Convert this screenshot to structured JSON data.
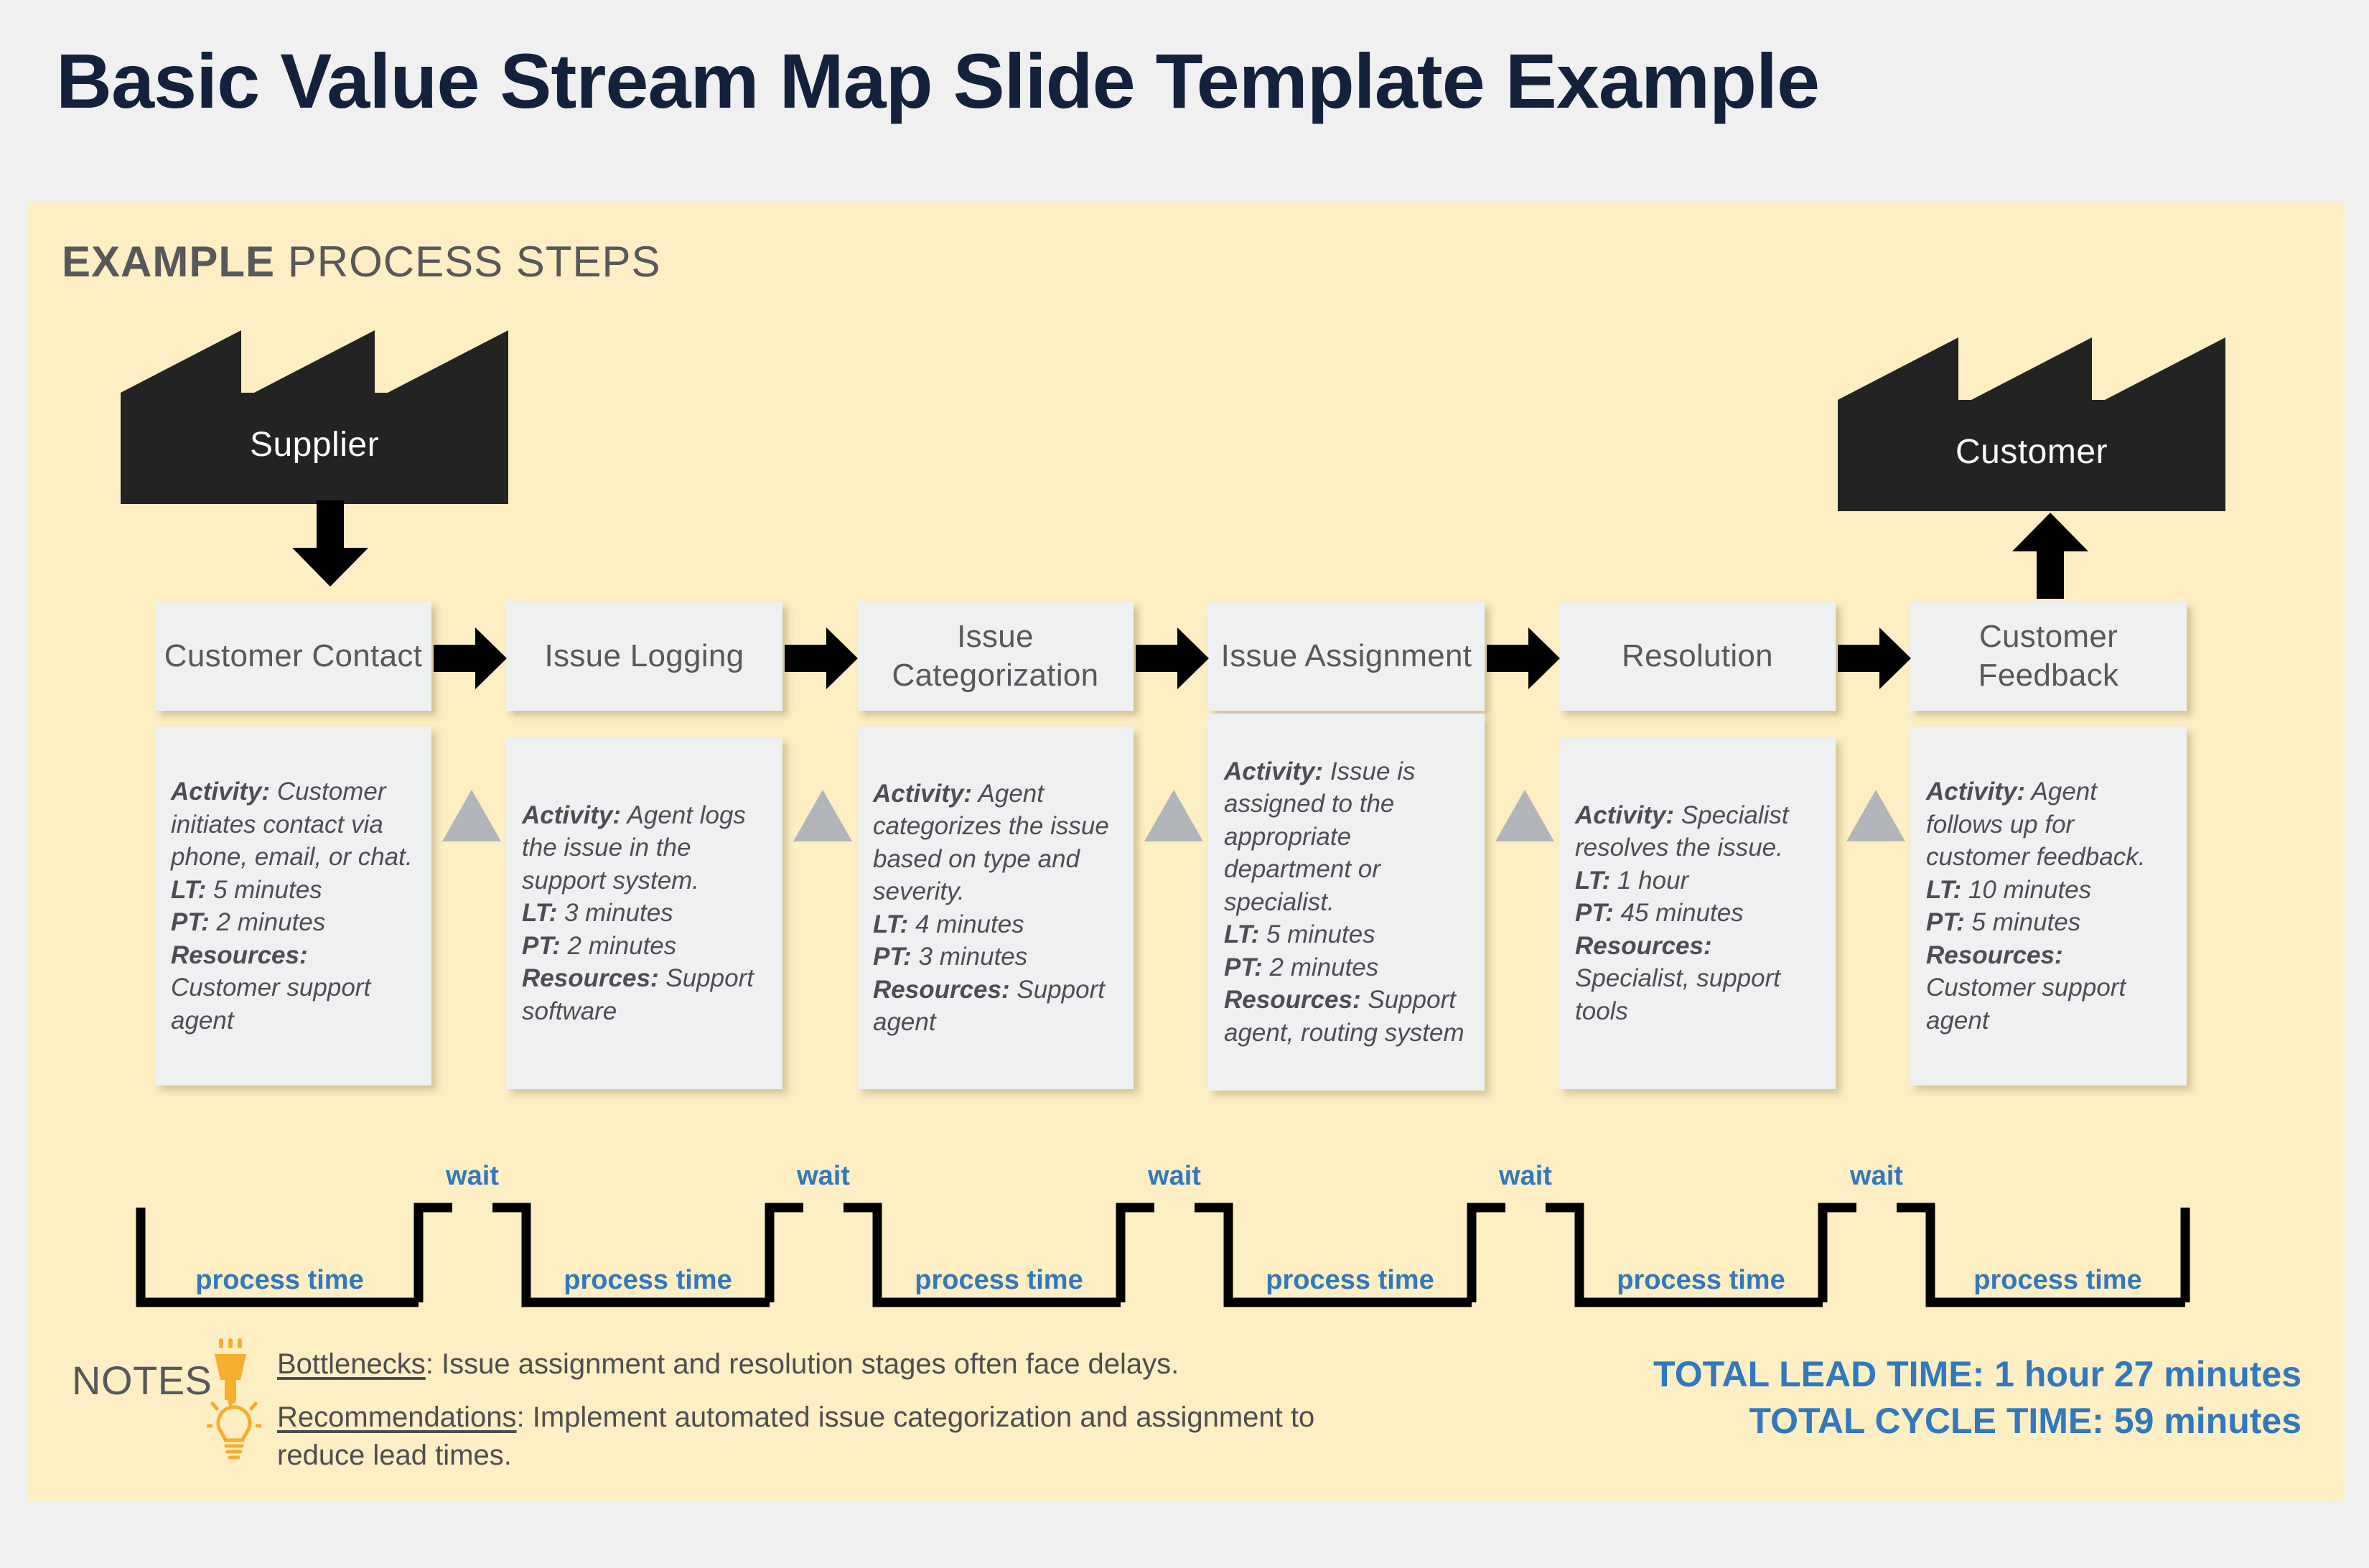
{
  "title": "Basic Value Stream Map Slide Template Example",
  "section": {
    "heading_strong": "EXAMPLE",
    "heading_light": " PROCESS STEPS"
  },
  "colors": {
    "page_background": "#f0f0f0",
    "panel_background": "#fdeec3",
    "title_navy": "#14213d",
    "box_gray": "#eef0f1",
    "text_gray": "#58575a",
    "accent_blue": "#3178be",
    "icon_orange": "#f5ae2e",
    "inventory_gray": "#b1b4b9",
    "factory_black": "#232323"
  },
  "endpoints": {
    "supplier": "Supplier",
    "customer": "Customer"
  },
  "process_steps": [
    {
      "title": "Customer Contact",
      "activity_label": "Activity:",
      "activity": " Customer initiates contact via phone, email, or chat.",
      "lt_label": "LT:",
      "lt": " 5 minutes",
      "pt_label": "PT:",
      "pt": " 2 minutes",
      "resources_label": "Resources:",
      "resources": " Customer support agent"
    },
    {
      "title": "Issue Logging",
      "activity_label": "Activity:",
      "activity": " Agent logs the issue in the support system.",
      "lt_label": "LT:",
      "lt": " 3 minutes",
      "pt_label": "PT:",
      "pt": " 2 minutes",
      "resources_label": "Resources:",
      "resources": " Support software"
    },
    {
      "title": "Issue Categorization",
      "activity_label": "Activity:",
      "activity": " Agent categorizes the issue based on type and severity.",
      "lt_label": "LT:",
      "lt": " 4 minutes",
      "pt_label": "PT:",
      "pt": " 3 minutes",
      "resources_label": "Resources:",
      "resources": " Support agent"
    },
    {
      "title": "Issue Assignment",
      "activity_label": "Activity:",
      "activity": " Issue is assigned to the appropriate department or specialist.",
      "lt_label": "LT:",
      "lt": " 5 minutes",
      "pt_label": "PT:",
      "pt": " 2 minutes",
      "resources_label": "Resources:",
      "resources": " Support agent, routing system"
    },
    {
      "title": "Resolution",
      "activity_label": "Activity:",
      "activity": " Specialist resolves the issue.",
      "lt_label": "LT:",
      "lt": " 1 hour",
      "pt_label": "PT:",
      "pt": " 45 minutes",
      "resources_label": "Resources:",
      "resources": " Specialist, support tools"
    },
    {
      "title": "Customer Feedback",
      "activity_label": "Activity:",
      "activity": " Agent follows up for customer feedback.",
      "lt_label": "LT:",
      "lt": " 10 minutes",
      "pt_label": "PT:",
      "pt": " 5 minutes",
      "resources_label": "Resources:",
      "resources": " Customer support agent"
    }
  ],
  "timeline": {
    "process_labels": [
      "process time",
      "process time",
      "process time",
      "process time",
      "process time",
      "process time"
    ],
    "wait_labels": [
      "wait",
      "wait",
      "wait",
      "wait",
      "wait"
    ]
  },
  "notes": {
    "word": "NOTES",
    "items": [
      {
        "icon": "highlighter-icon",
        "label": "Bottlenecks",
        "text": ": Issue assignment and resolution stages often face delays."
      },
      {
        "icon": "lightbulb-icon",
        "label": "Recommendations",
        "text": ":  Implement automated issue categorization and assignment to reduce lead times."
      }
    ]
  },
  "totals": {
    "lead_time": "TOTAL LEAD TIME: 1 hour 27 minutes",
    "cycle_time": "TOTAL CYCLE TIME: 59 minutes"
  }
}
